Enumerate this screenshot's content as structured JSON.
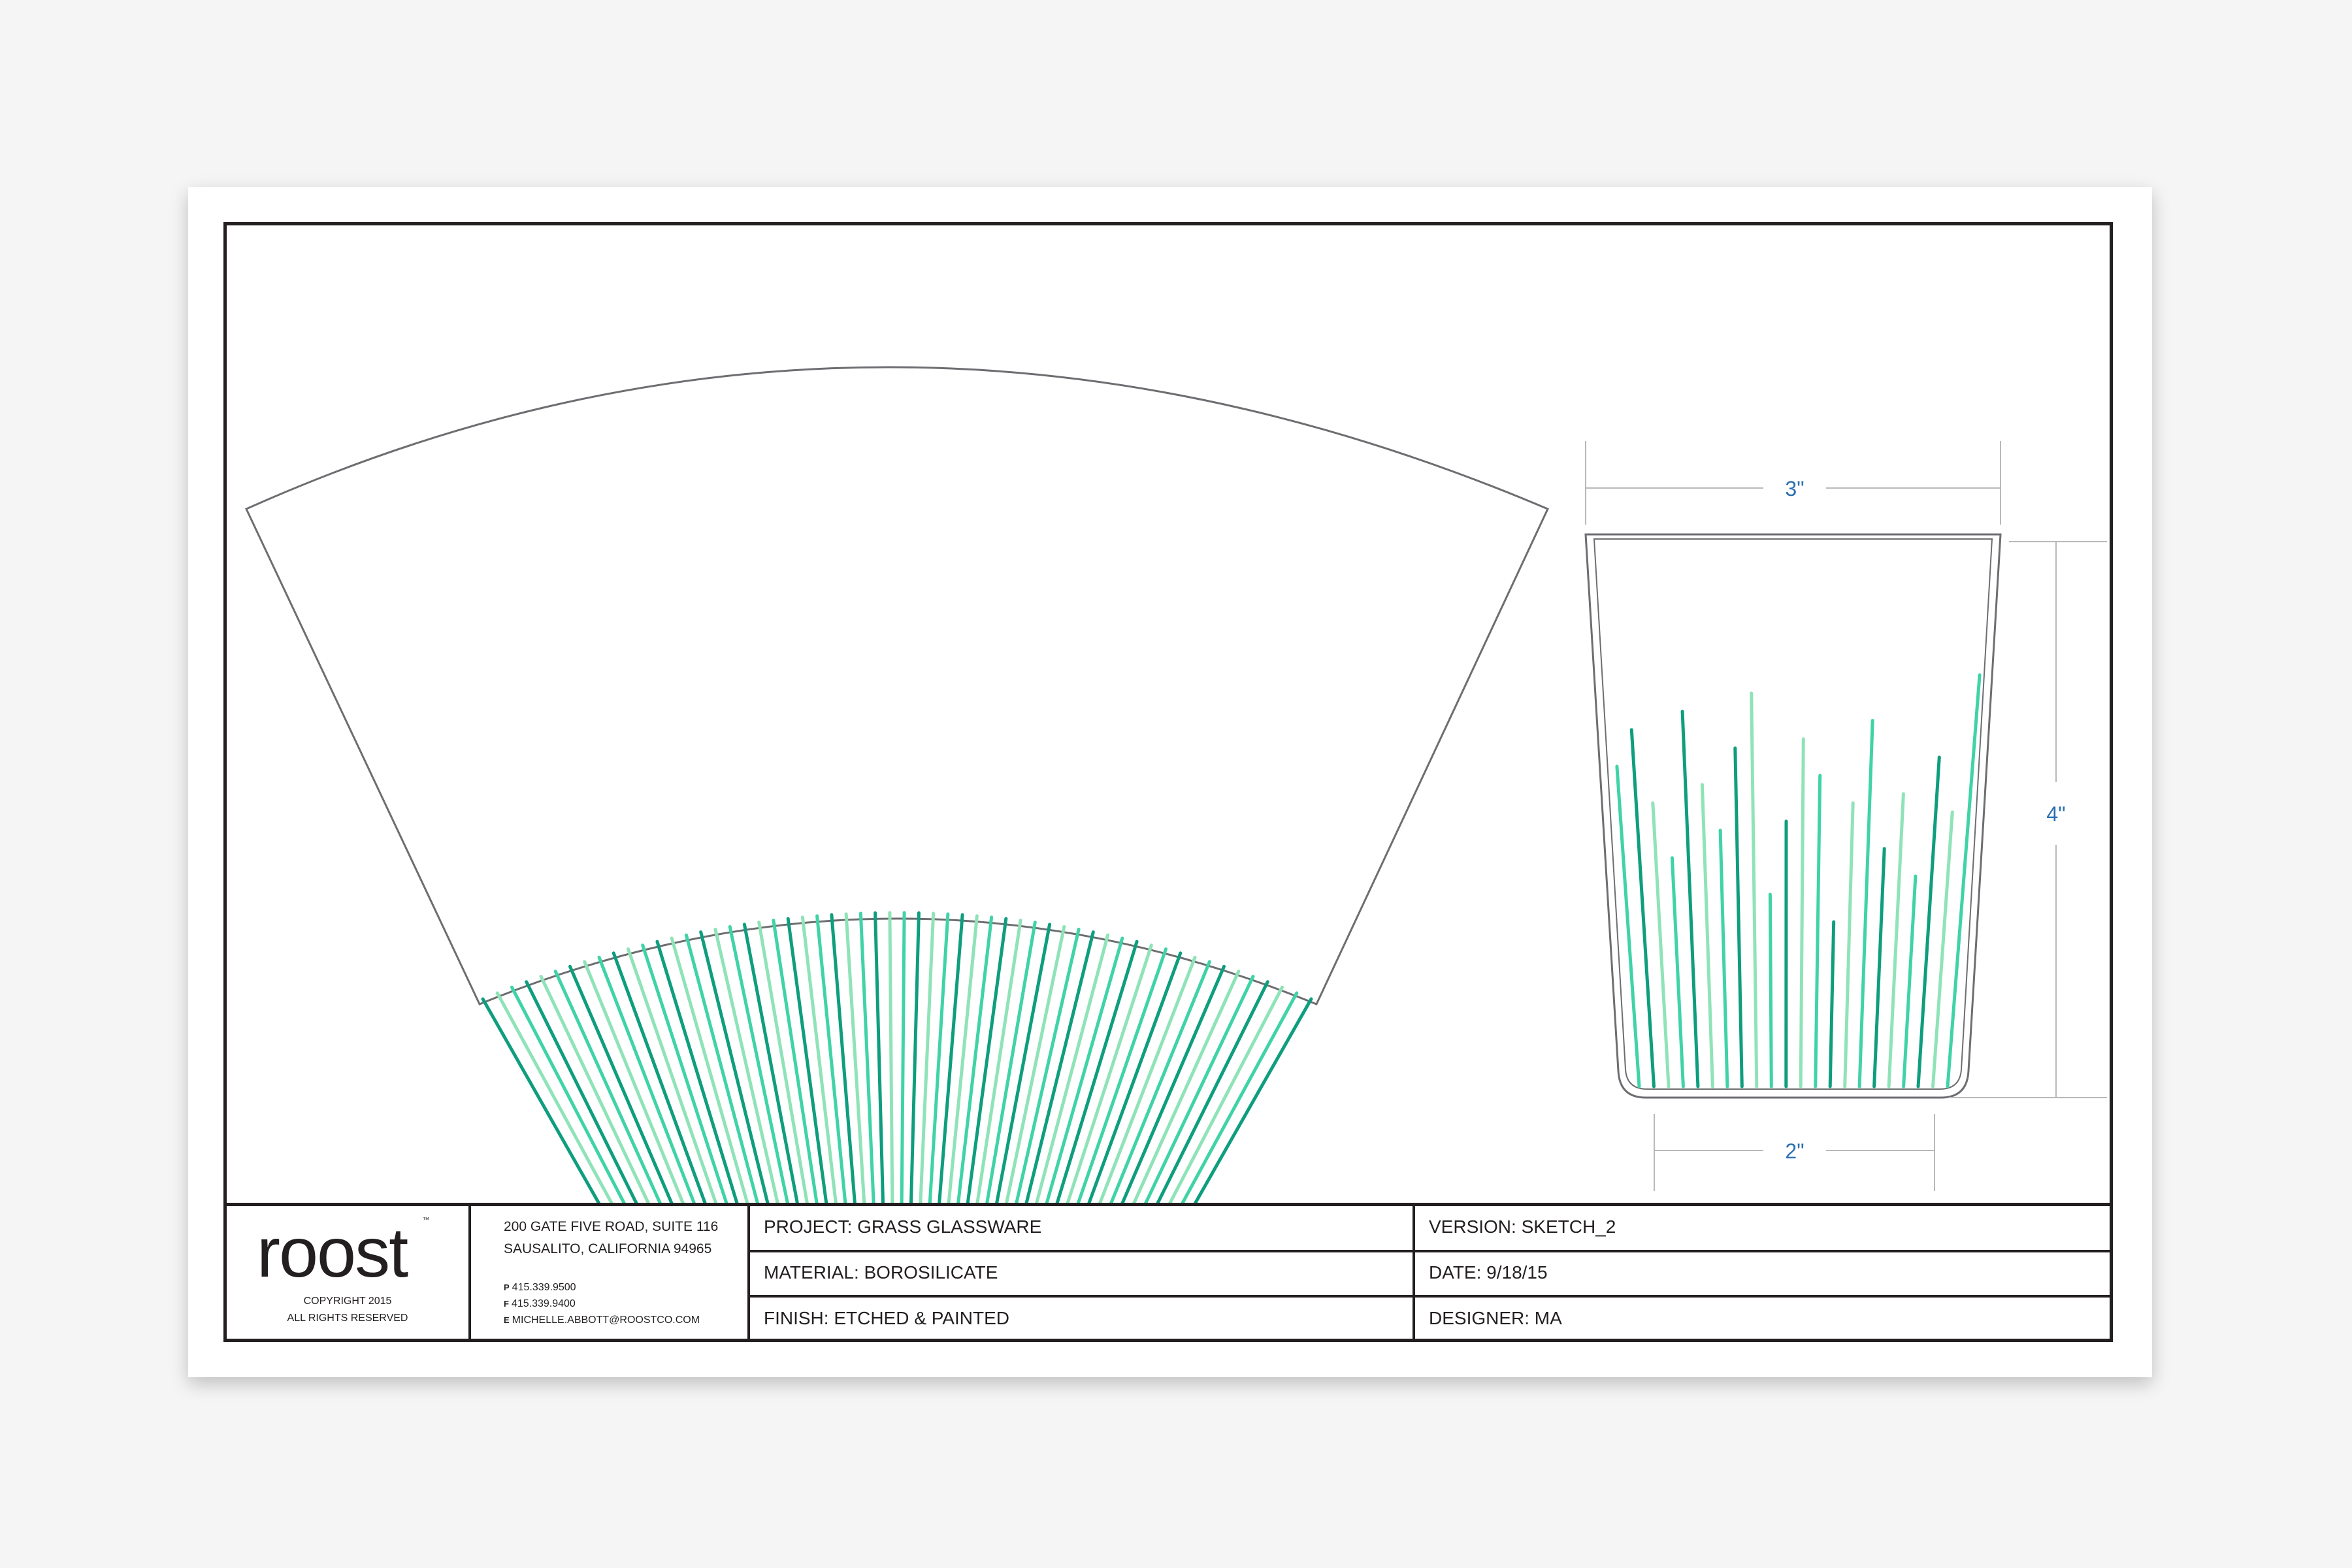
{
  "company": {
    "logo": "roost",
    "trademark": "™",
    "copyright_line1": "COPYRIGHT 2015",
    "copyright_line2": "ALL RIGHTS RESERVED",
    "address_line1": "200 GATE FIVE ROAD, SUITE 116",
    "address_line2": "SAUSALITO, CALIFORNIA 94965",
    "phone_prefix": "P",
    "phone": "415.339.9500",
    "fax_prefix": "F",
    "fax": "415.339.9400",
    "email_prefix": "E",
    "email": "MICHELLE.ABBOTT@ROOSTCO.COM"
  },
  "fields": {
    "project": "PROJECT: GRASS GLASSWARE",
    "material": "MATERIAL: BOROSILICATE",
    "finish": "FINISH: ETCHED & PAINTED",
    "version": "VERSION: SKETCH_2",
    "date": "DATE: 9/18/15",
    "designer": "DESIGNER: MA"
  },
  "dimensions": {
    "top_width": "3\"",
    "height": "4\"",
    "bottom_width": "2\""
  },
  "colors": {
    "grass_dark": "#0e9e7e",
    "grass_mid": "#3fd3a6",
    "grass_light": "#8fe3b8",
    "outline": "#6d6e71",
    "dimension_text": "#2a6fb0",
    "dimension_line": "#b9b9b9"
  }
}
